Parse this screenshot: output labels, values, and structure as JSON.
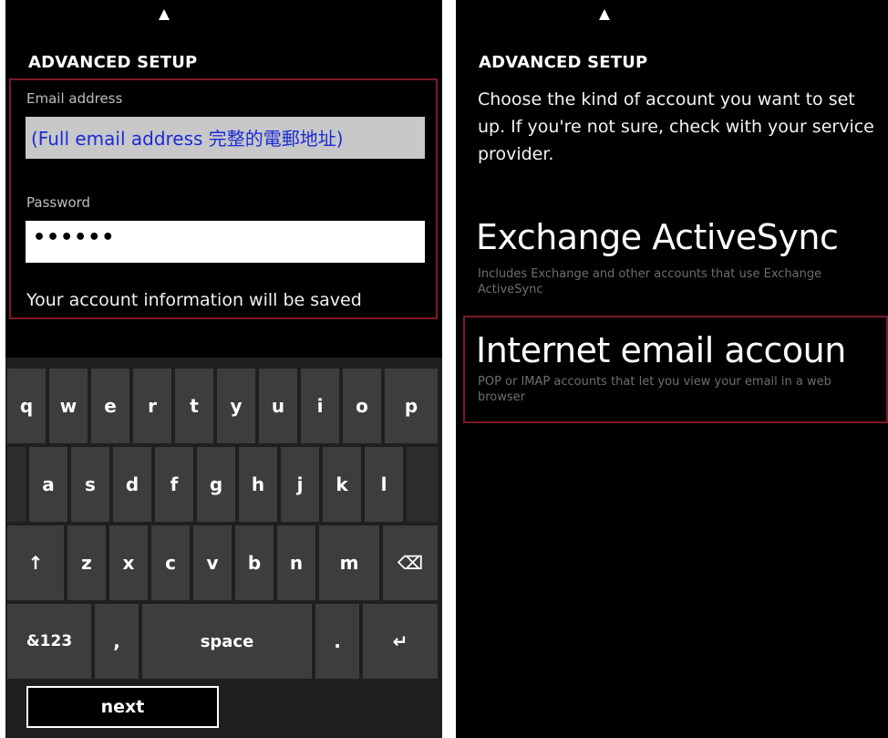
{
  "left_screen": {
    "title": "ADVANCED SETUP",
    "email_label": "Email address",
    "email_value": "(Full email address 完整的電郵地址)",
    "password_label": "Password",
    "password_value": "••••••",
    "save_note": "Your account information will be saved",
    "keyboard": {
      "row1": [
        "q",
        "w",
        "e",
        "r",
        "t",
        "y",
        "u",
        "i",
        "o",
        "p"
      ],
      "row2": [
        "a",
        "s",
        "d",
        "f",
        "g",
        "h",
        "j",
        "k",
        "l"
      ],
      "row3": [
        "↑",
        "z",
        "x",
        "c",
        "v",
        "b",
        "n",
        "m",
        "⌫"
      ],
      "row4": [
        "&123",
        ",",
        "space",
        ".",
        "↵"
      ]
    },
    "next_label": "next"
  },
  "right_screen": {
    "title": "ADVANCED SETUP",
    "description": "Choose the kind of account you want to set up. If you're not sure, check with your service provider.",
    "options": [
      {
        "title": "Exchange ActiveSync",
        "description": "Includes Exchange and other accounts that use Exchange ActiveSync"
      },
      {
        "title": "Internet email accoun",
        "description": "POP or IMAP accounts that let you view your email in a web browser"
      }
    ]
  },
  "colors": {
    "background": "#000000",
    "highlight_border": "#7a1b2a",
    "email_text": "#1b2bd6",
    "key": "#3d3d3d"
  }
}
